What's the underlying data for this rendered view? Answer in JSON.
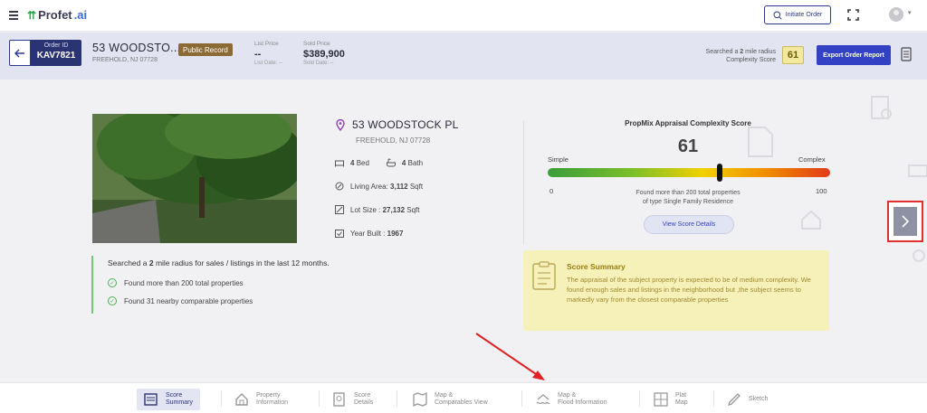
{
  "app": {
    "logo_text": "Profet",
    "logo_suffix": ".ai"
  },
  "topbar": {
    "initiate_label": "Initiate Order"
  },
  "order": {
    "id_label": "Order ID",
    "id_value": "KAV7821",
    "address": "53 WOODSTO...",
    "city": "FREEHOLD, NJ 07728",
    "badge": "Public Record",
    "list_price_label": "List Price",
    "list_price_value": "--",
    "list_date": "List Date: --",
    "sold_price_label": "Sold Price",
    "sold_price_value": "$389,900",
    "sold_date": "Sold Date: --",
    "search_line1_pre": "Searched a ",
    "search_line1_num": "2",
    "search_line1_post": " mile radius",
    "search_line2": "Complexity Score",
    "score": "61",
    "export_label": "Export Order Report"
  },
  "property": {
    "title": "53 WOODSTOCK PL",
    "city": "FREEHOLD, NJ 07728",
    "bed_count": "4",
    "bed_label": "Bed",
    "bath_count": "4",
    "bath_label": "Bath",
    "living_label": "Living Area: ",
    "living_value": "3,112",
    "living_unit": " Sqft",
    "lot_label": "Lot Size : ",
    "lot_value": "27,132",
    "lot_unit": " Sqft",
    "year_label": "Year Built : ",
    "year_value": "1967"
  },
  "complexity": {
    "title": "PropMix Appraisal Complexity Score",
    "score": "61",
    "score_fraction": 0.61,
    "low_label": "Simple",
    "high_label": "Complex",
    "min": "0",
    "max": "100",
    "found_line1": "Found more than 200 total properties",
    "found_line2": "of type Single Family Residence",
    "view_button": "View Score Details"
  },
  "radius": {
    "pre": "Searched a ",
    "num": "2",
    "post": " mile radius for sales / listings in the last 12 months.",
    "items": [
      "Found more than 200 total properties",
      "Found 31 nearby comparable properties"
    ]
  },
  "summary": {
    "title": "Score Summary",
    "text": "The appraisal of the subject property is expected to be of medium complexity. We found enough sales and listings in the neighborhood but ,the subject seems to markedly vary from the closest comparable properties"
  },
  "tabs": [
    {
      "line1": "Score",
      "line2": "Summary",
      "icon": "score-summary-icon",
      "active": true
    },
    {
      "line1": "Property",
      "line2": "Information",
      "icon": "house-icon"
    },
    {
      "line1": "Score",
      "line2": "Details",
      "icon": "score-details-icon"
    },
    {
      "line1": "Map &",
      "line2": "Comparables View",
      "icon": "map-icon"
    },
    {
      "line1": "Map &",
      "line2": "Flood Information",
      "icon": "flood-icon"
    },
    {
      "line1": "Plat",
      "line2": "Map",
      "icon": "plat-icon"
    },
    {
      "line1": "Sketch",
      "line2": "",
      "icon": "sketch-icon"
    }
  ],
  "colors": {
    "brand": "#2b3473",
    "accent": "#3342c4",
    "highlight": "#e23030",
    "summary_bg": "#f6f0b9"
  }
}
